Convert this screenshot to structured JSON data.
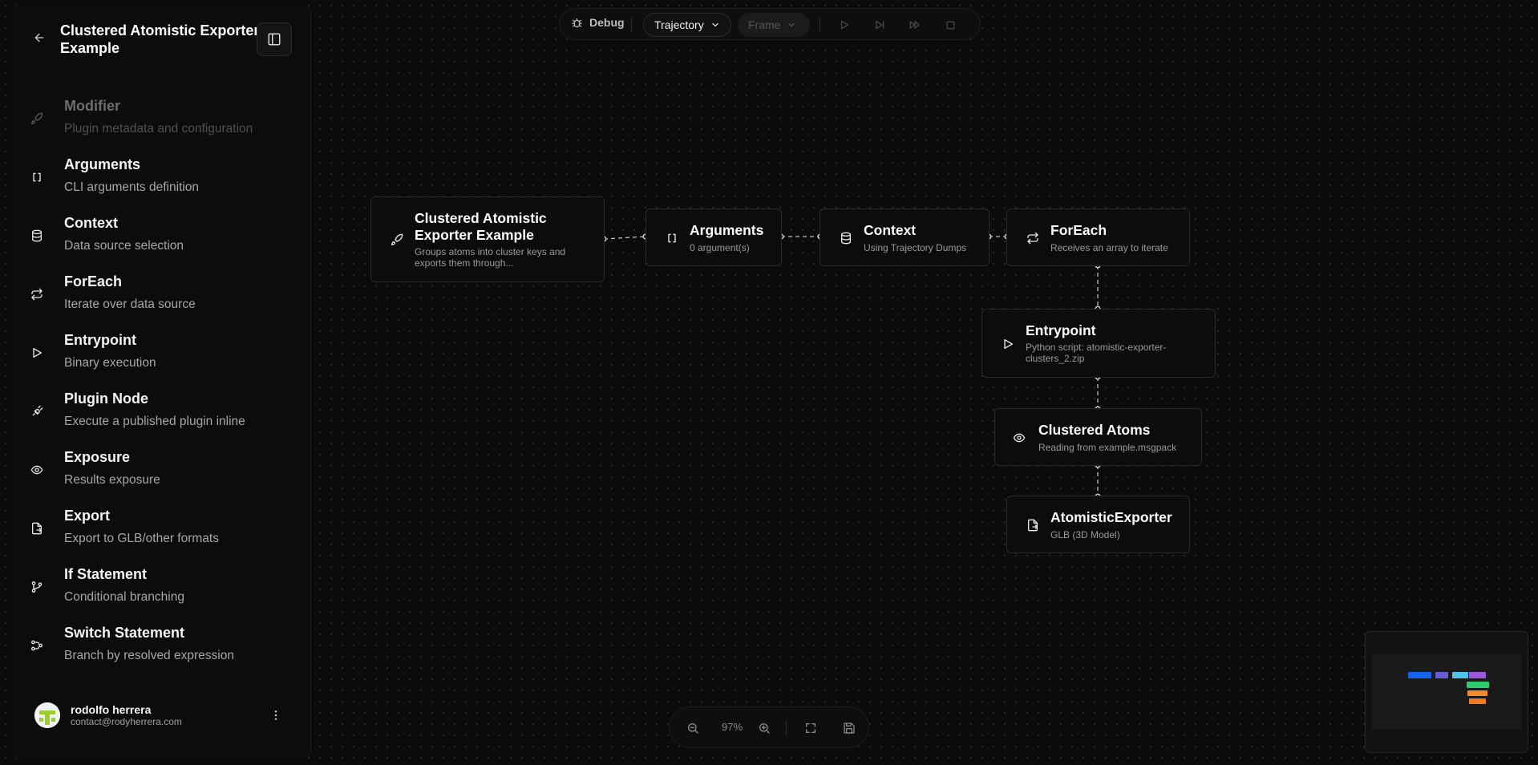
{
  "sidebar": {
    "title": "Clustered Atomistic Exporter Example",
    "items": [
      {
        "label": "Modifier",
        "desc": "Plugin metadata and configuration",
        "icon": "rocket-icon",
        "disabled": true
      },
      {
        "label": "Arguments",
        "desc": "CLI arguments definition",
        "icon": "brackets-icon"
      },
      {
        "label": "Context",
        "desc": "Data source selection",
        "icon": "database-icon"
      },
      {
        "label": "ForEach",
        "desc": "Iterate over data source",
        "icon": "repeat-icon"
      },
      {
        "label": "Entrypoint",
        "desc": "Binary execution",
        "icon": "play-icon"
      },
      {
        "label": "Plugin Node",
        "desc": "Execute a published plugin inline",
        "icon": "plugin-icon"
      },
      {
        "label": "Exposure",
        "desc": "Results exposure",
        "icon": "eye-icon"
      },
      {
        "label": "Export",
        "desc": "Export to GLB/other formats",
        "icon": "file-export-icon"
      },
      {
        "label": "If Statement",
        "desc": "Conditional branching",
        "icon": "git-branch-icon"
      },
      {
        "label": "Switch Statement",
        "desc": "Branch by resolved expression",
        "icon": "switch-icon"
      }
    ],
    "user": {
      "name": "rodolfo herrera",
      "email": "contact@rodyherrera.com"
    }
  },
  "toolbar": {
    "debug_label": "Debug",
    "trajectory_label": "Trajectory",
    "frame_label": "Frame"
  },
  "nodes": {
    "modifier": {
      "title": "Clustered Atomistic Exporter Example",
      "subtitle": "Groups atoms into cluster keys and exports them through..."
    },
    "arguments": {
      "title": "Arguments",
      "subtitle": "0 argument(s)"
    },
    "context": {
      "title": "Context",
      "subtitle": "Using Trajectory Dumps"
    },
    "foreach": {
      "title": "ForEach",
      "subtitle": "Receives an array to iterate"
    },
    "entrypoint": {
      "title": "Entrypoint",
      "subtitle": "Python script: atomistic-exporter-clusters_2.zip"
    },
    "exposure": {
      "title": "Clustered Atoms",
      "subtitle": "Reading from example.msgpack"
    },
    "export": {
      "title": "AtomisticExporter",
      "subtitle": "GLB (3D Model)"
    }
  },
  "zoom": {
    "percent": "97%"
  },
  "colors": {
    "background": "#0b0b0b",
    "node_border": "#2a2a2a",
    "minimap_modifier": "#1463f0",
    "minimap_arguments": "#6a5cd8",
    "minimap_context": "#4fc3e8",
    "minimap_foreach": "#9b59e0",
    "minimap_entrypoint": "#2ecc71",
    "minimap_exposure": "#f08a2c",
    "minimap_export": "#f07a1c"
  }
}
